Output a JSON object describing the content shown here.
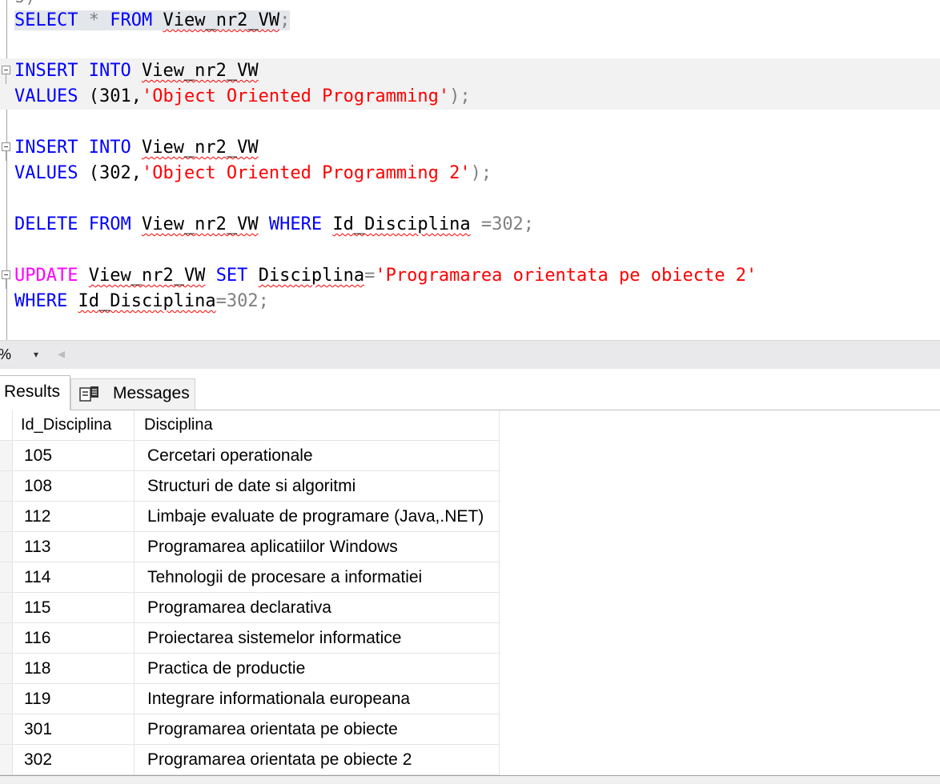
{
  "editor": {
    "partial_top": "s)",
    "lines": {
      "l1": {
        "kw1": "SELECT",
        "op": " * ",
        "kw2": "FROM",
        "obj": "View_nr2_VW",
        "end": ";"
      },
      "l2": {
        "kw1": "INSERT INTO",
        "obj": "View_nr2_VW"
      },
      "l3": {
        "kw1": "VALUES",
        "open": " (301,",
        "str": "'Object Oriented Programming'",
        "end": ");"
      },
      "l4": {
        "kw1": "INSERT INTO",
        "obj": "View_nr2_VW"
      },
      "l5": {
        "kw1": "VALUES",
        "open": " (302,",
        "str": "'Object Oriented Programming 2'",
        "end": ");"
      },
      "l6": {
        "kw1": "DELETE FROM",
        "obj": "View_nr2_VW",
        "kw2": "WHERE",
        "col": "Id_Disciplina",
        "end": " =302;"
      },
      "l7": {
        "kw1": "UPDATE",
        "obj": "View_nr2_VW",
        "kw2": "SET",
        "col": "Disciplina",
        "eq": "=",
        "str": "'Programarea orientata pe obiecte 2'"
      },
      "l8": {
        "kw1": "WHERE",
        "col": "Id_Disciplina",
        "end": "=302;"
      }
    }
  },
  "zoom": {
    "value": "%",
    "dropdown": "▾",
    "scroll_left": "◂"
  },
  "tabs": {
    "results": "Results",
    "messages": "Messages"
  },
  "grid": {
    "columns": [
      "Id_Disciplina",
      "Disciplina"
    ],
    "rows": [
      {
        "id": "105",
        "name": "Cercetari operationale"
      },
      {
        "id": "108",
        "name": "Structuri de date si algoritmi"
      },
      {
        "id": "112",
        "name": "Limbaje evaluate de programare (Java,.NET)"
      },
      {
        "id": "113",
        "name": "Programarea aplicatiilor Windows"
      },
      {
        "id": "114",
        "name": "Tehnologii de procesare a informatiei"
      },
      {
        "id": "115",
        "name": "Programarea declarativa"
      },
      {
        "id": "116",
        "name": "Proiectarea sistemelor informatice"
      },
      {
        "id": "118",
        "name": "Practica de productie"
      },
      {
        "id": "119",
        "name": "Integrare informationala europeana"
      },
      {
        "id": "301",
        "name": "Programarea orientata pe obiecte"
      },
      {
        "id": "302",
        "name": "Programarea orientata pe obiecte 2"
      }
    ]
  },
  "colors": {
    "keyword": "#0000ff",
    "string": "#ff0000",
    "operator": "#808080",
    "update_keyword": "#ff00ff"
  }
}
